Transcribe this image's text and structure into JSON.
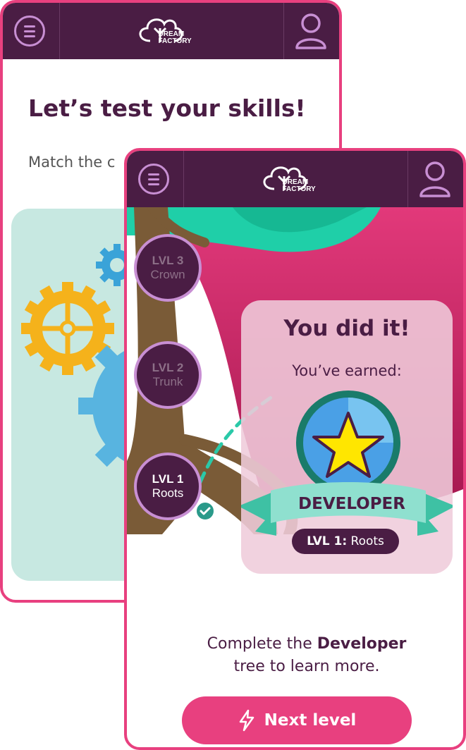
{
  "app": {
    "logo_line1": "DREAM",
    "logo_line2": "FACTORY"
  },
  "back_screen": {
    "title": "Let’s test your skills!",
    "subtitle": "Match the c"
  },
  "front_screen": {
    "levels": [
      {
        "level": "LVL 3",
        "name": "Crown",
        "state": "locked"
      },
      {
        "level": "LVL 2",
        "name": "Trunk",
        "state": "locked"
      },
      {
        "level": "LVL 1",
        "name": "Roots",
        "state": "completed"
      }
    ],
    "card": {
      "title": "You did it!",
      "subtitle": "You’ve earned:",
      "badge_name": "DEVELOPER",
      "badge_level_prefix": "LVL 1:",
      "badge_level_name": "Roots"
    },
    "description": {
      "part1": "Complete the",
      "bold": "Developer",
      "part2": "tree to learn more."
    },
    "next_button": {
      "label": "Next level"
    }
  },
  "colors": {
    "brand_purple": "#4a1d44",
    "accent_pink": "#e8407f",
    "lilac": "#c88fd3",
    "teal": "#2a9a8a",
    "scene_red": "#c9185d",
    "trunk": "#7a5b37",
    "canopy": "#1fcfa8",
    "star": "#ffe600"
  },
  "icons": [
    "hamburger-menu-icon",
    "dream-factory-logo",
    "user-profile-icon",
    "gear-icon",
    "checkmark-icon",
    "lightning-icon",
    "star-icon"
  ]
}
